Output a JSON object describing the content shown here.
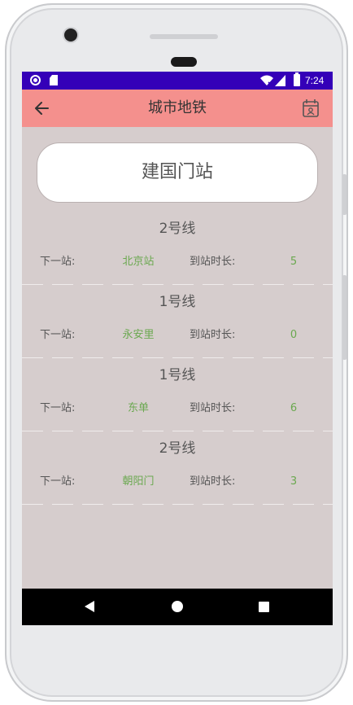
{
  "status_bar": {
    "time": "7:24"
  },
  "app_bar": {
    "title": "城市地铁"
  },
  "station": {
    "name": "建国门站"
  },
  "labels": {
    "next_station": "下一站:",
    "arrival_time": "到站时长:"
  },
  "trains": [
    {
      "line": "2号线",
      "next_station": "北京站",
      "minutes": "5"
    },
    {
      "line": "1号线",
      "next_station": "永安里",
      "minutes": "0"
    },
    {
      "line": "1号线",
      "next_station": "东单",
      "minutes": "6"
    },
    {
      "line": "2号线",
      "next_station": "朝阳门",
      "minutes": "3"
    }
  ],
  "colors": {
    "status_bar": "#3400b8",
    "app_bar": "#f4908d",
    "content_background": "#d6cdcd",
    "value_text": "#6aa84f"
  },
  "icons": {
    "back": "arrow-left-icon",
    "calendar": "calendar-icon",
    "nav_back": "triangle-back-icon",
    "nav_home": "circle-home-icon",
    "nav_recent": "square-recent-icon"
  }
}
